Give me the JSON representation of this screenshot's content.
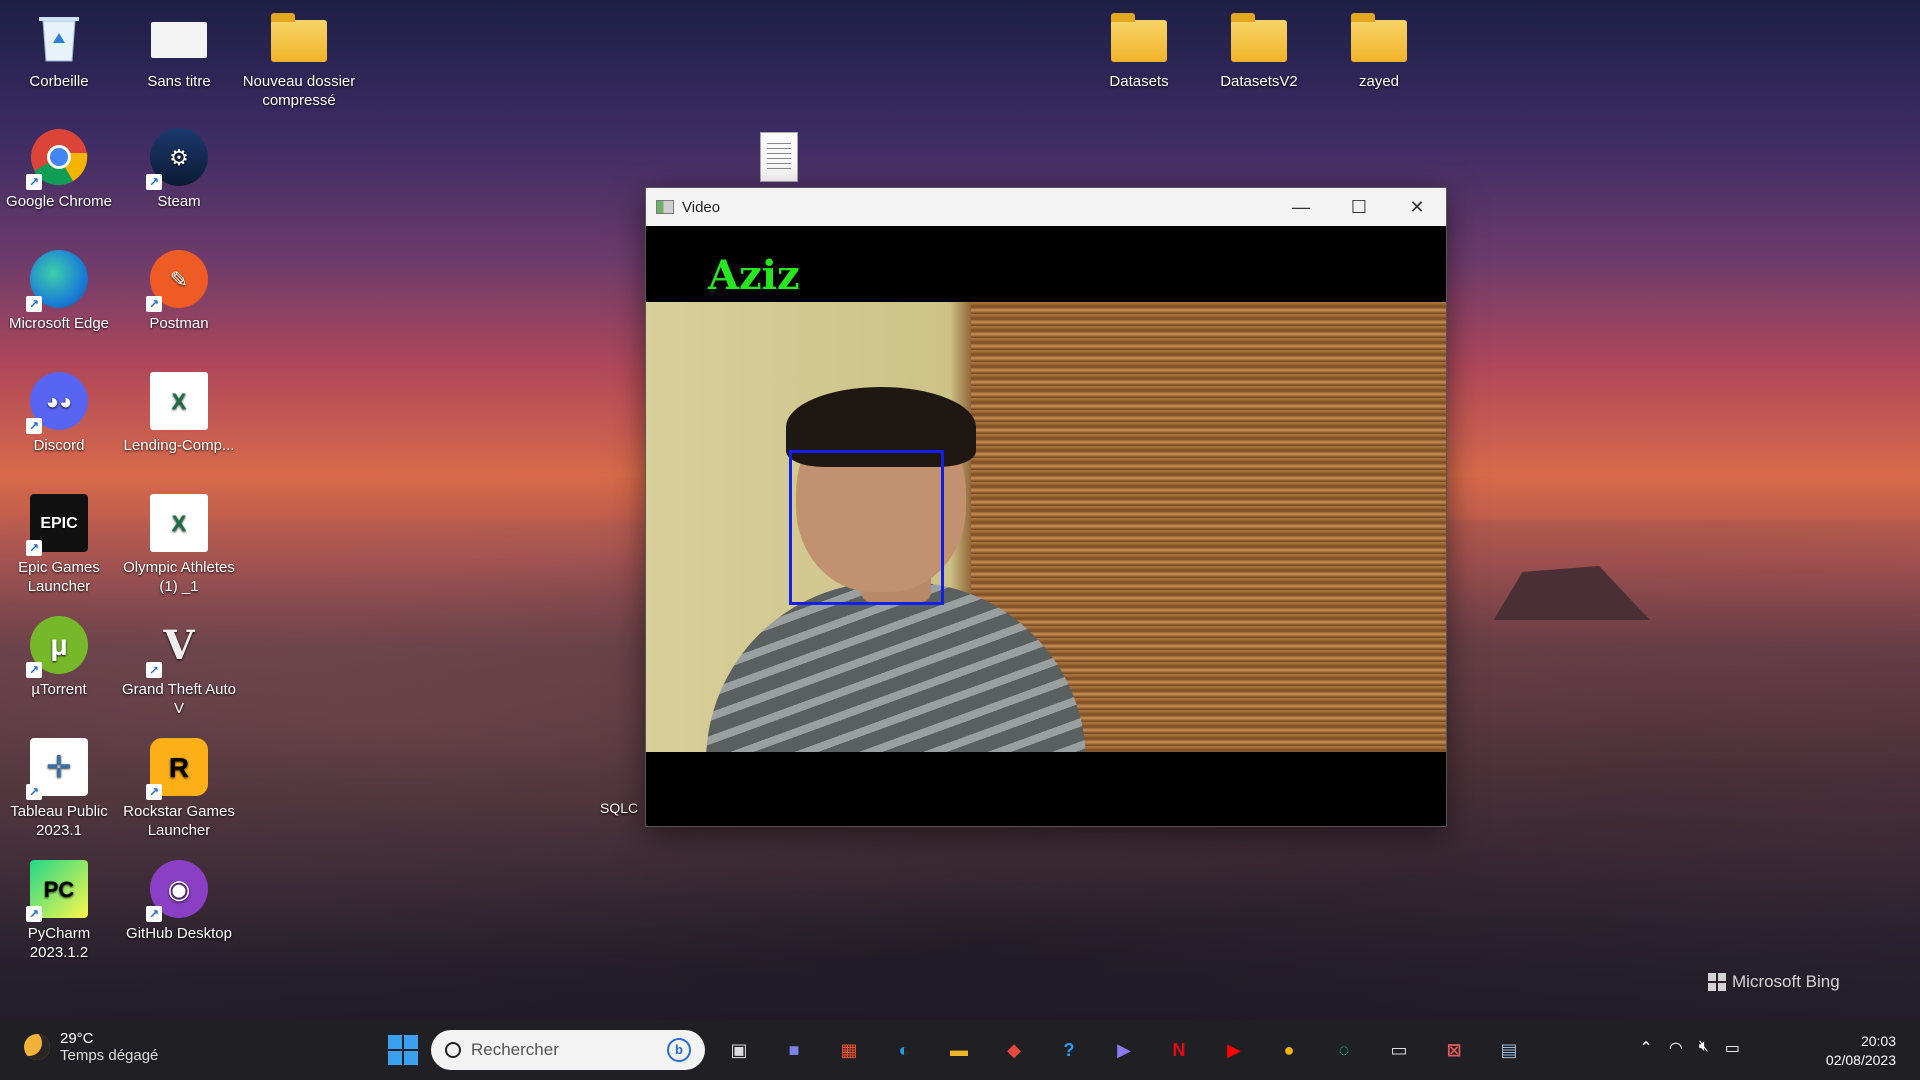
{
  "desktop": {
    "icons": [
      {
        "label": "Corbeille",
        "icon": "recycle-bin-icon"
      },
      {
        "label": "Sans titre",
        "icon": "document-icon"
      },
      {
        "label": "Nouveau dossier compressé",
        "icon": "zip-folder-icon"
      },
      {
        "label": "Google Chrome",
        "icon": "chrome-icon"
      },
      {
        "label": "Steam",
        "icon": "steam-icon"
      },
      {
        "label": "Microsoft Edge",
        "icon": "edge-icon"
      },
      {
        "label": "Postman",
        "icon": "postman-icon"
      },
      {
        "label": "Discord",
        "icon": "discord-icon"
      },
      {
        "label": "Lending-Comp...",
        "icon": "excel-icon"
      },
      {
        "label": "Epic Games Launcher",
        "icon": "epic-games-icon"
      },
      {
        "label": "Olympic Athletes (1) _1",
        "icon": "excel-icon"
      },
      {
        "label": "µTorrent",
        "icon": "utorrent-icon"
      },
      {
        "label": "Grand Theft Auto V",
        "icon": "gta-icon"
      },
      {
        "label": "Tableau Public 2023.1",
        "icon": "tableau-icon"
      },
      {
        "label": "Rockstar Games Launcher",
        "icon": "rockstar-icon"
      },
      {
        "label": "PyCharm 2023.1.2",
        "icon": "pycharm-icon"
      },
      {
        "label": "GitHub Desktop",
        "icon": "github-icon"
      },
      {
        "label": "Datasets",
        "icon": "folder-icon"
      },
      {
        "label": "DatasetsV2",
        "icon": "folder-icon"
      },
      {
        "label": "zayed",
        "icon": "folder-icon"
      },
      {
        "label": "SQLC",
        "icon": "file-icon"
      }
    ],
    "watermark": "Microsoft Bing"
  },
  "video_window": {
    "title": "Video",
    "overlay_name": "Aziz",
    "face_box_color": "#1020e6",
    "name_color": "#25e81f"
  },
  "taskbar": {
    "weather_temp": "29°C",
    "weather_desc": "Temps dégagé",
    "search_placeholder": "Rechercher",
    "time": "20:03",
    "date": "02/08/2023"
  }
}
